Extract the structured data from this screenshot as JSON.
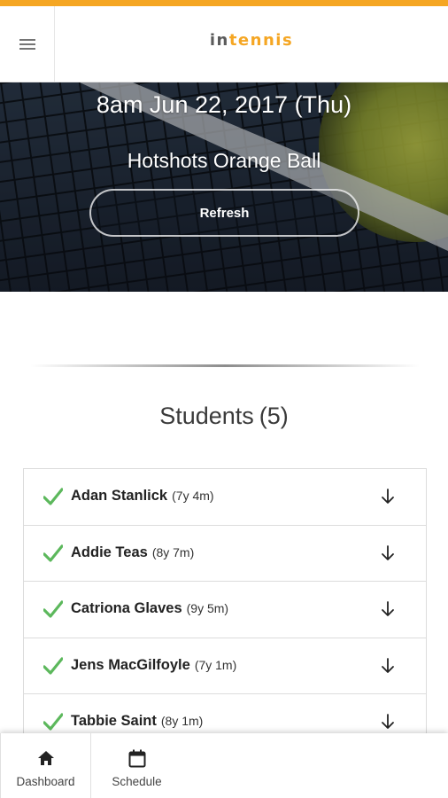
{
  "header": {
    "menu_icon": "hamburger-menu-icon",
    "logo_in": "in",
    "logo_tennis": "tennis",
    "accent_color": "#f5a623"
  },
  "session": {
    "datetime": "8am Jun 22, 2017 (Thu)",
    "class_name": "Hotshots Orange Ball",
    "refresh_label": "Refresh",
    "background": "tennis-net-and-ball-photo"
  },
  "students": {
    "heading": "Students",
    "count": "(5)",
    "check_color": "#5cb85c",
    "items": [
      {
        "name": "Adan Stanlick",
        "age": "(7y 4m)",
        "status_icon": "checkmark-icon",
        "action_icon": "arrow-down-icon"
      },
      {
        "name": "Addie Teas",
        "age": "(8y 7m)",
        "status_icon": "checkmark-icon",
        "action_icon": "arrow-down-icon"
      },
      {
        "name": "Catriona Glaves",
        "age": "(9y 5m)",
        "status_icon": "checkmark-icon",
        "action_icon": "arrow-down-icon"
      },
      {
        "name": "Jens MacGilfoyle",
        "age": "(7y 1m)",
        "status_icon": "checkmark-icon",
        "action_icon": "arrow-down-icon"
      },
      {
        "name": "Tabbie Saint",
        "age": "(8y 1m)",
        "status_icon": "checkmark-icon",
        "action_icon": "arrow-down-icon"
      }
    ]
  },
  "bottom_nav": {
    "items": [
      {
        "label": "Dashboard",
        "icon": "home-icon",
        "active": true
      },
      {
        "label": "Schedule",
        "icon": "calendar-icon",
        "active": false
      }
    ]
  }
}
